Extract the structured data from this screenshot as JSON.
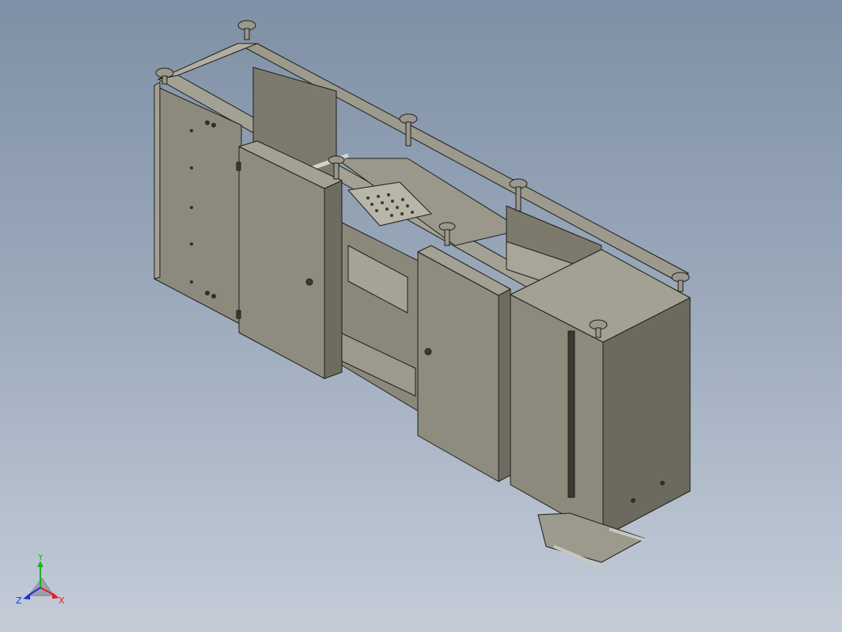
{
  "viewport": {
    "background_top": "#7f90a6",
    "background_bottom": "#c4ccd8"
  },
  "model": {
    "panel_color": "#8c8a7c",
    "panel_dark": "#6e6c60",
    "panel_light": "#a3a193",
    "frame_color": "#9c9a8d",
    "edge_color": "#1e1e1a"
  },
  "triad": {
    "x_label": "X",
    "y_label": "Y",
    "z_label": "Z",
    "x_color": "#e02020",
    "y_color": "#20b020",
    "z_color": "#2030e0"
  }
}
